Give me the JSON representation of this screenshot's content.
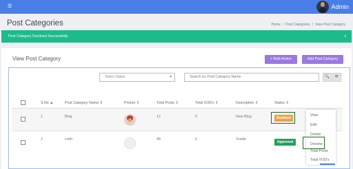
{
  "topbar": {
    "menu_icon": "hamburger-icon",
    "admin_label": "Admin",
    "color": "#4a7ee7"
  },
  "page_title": "Post Categories",
  "breadcrumb": {
    "home": "Home",
    "sep1": "/",
    "categories": "Post Categories",
    "sep2": "/",
    "current": "View Post Category"
  },
  "alert": {
    "message": "Post Category Declined Successfully",
    "close": "x",
    "color": "#1cbb8c"
  },
  "card": {
    "title": "View Post Category",
    "bulk_action": "+ Bulk Action",
    "add_category": "Add Post Category"
  },
  "filters": {
    "status_placeholder": "Select Status",
    "status_caret": "▾",
    "search_placeholder": "Search by Post Category Name",
    "search_icon": "🔍",
    "refresh_icon": "⟳"
  },
  "table": {
    "headers": [
      {
        "label": "S.No",
        "sort": "▲"
      },
      {
        "label": "Post Category Name",
        "sort": "⇕"
      },
      {
        "label": "Picture",
        "sort": "⇕"
      },
      {
        "label": "Total Posts",
        "sort": "⇕"
      },
      {
        "label": "Total VOD's",
        "sort": "⇕"
      },
      {
        "label": "Description",
        "sort": "⇕"
      },
      {
        "label": "Status",
        "sort": "⇕"
      }
    ],
    "rows": [
      {
        "sno": "1",
        "name": "Blog",
        "total_posts": "12",
        "total_vods": "0",
        "description": "New Blog",
        "status": "Declined"
      },
      {
        "sno": "2",
        "name": "cloth",
        "total_posts": "48",
        "total_vods": "0",
        "description": "Textile",
        "status": "Approved"
      }
    ]
  },
  "action_menu": {
    "items": [
      "View",
      "Edit",
      "Delete",
      "Decline",
      "Total Posts",
      "Total VOD's"
    ]
  },
  "colors": {
    "declined": "#f0a043",
    "approved": "#1fa25a",
    "button": "#9b79e0",
    "highlight": "#1d6b1d"
  }
}
